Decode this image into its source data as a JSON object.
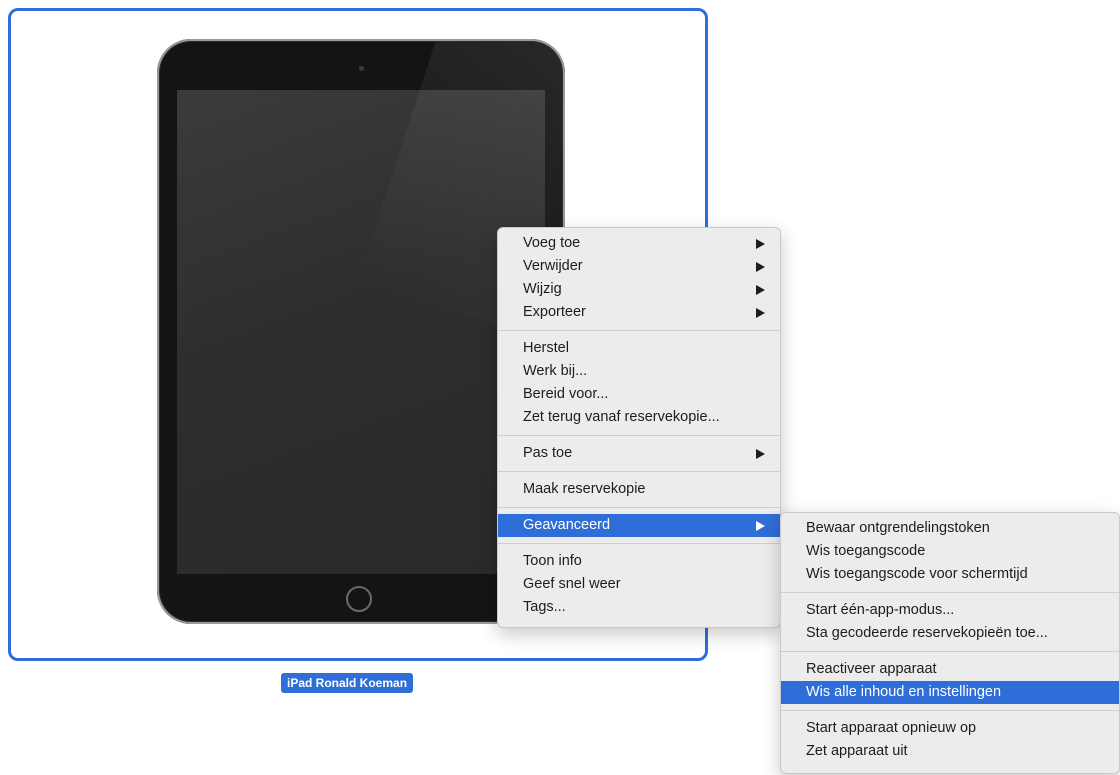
{
  "device": {
    "name": "iPad Ronald Koeman",
    "selected": true
  },
  "context_menu": {
    "groups": [
      [
        {
          "label": "Voeg toe",
          "submenu": true
        },
        {
          "label": "Verwijder",
          "submenu": true
        },
        {
          "label": "Wijzig",
          "submenu": true
        },
        {
          "label": "Exporteer",
          "submenu": true
        }
      ],
      [
        {
          "label": "Herstel"
        },
        {
          "label": "Werk bij..."
        },
        {
          "label": "Bereid voor..."
        },
        {
          "label": "Zet terug vanaf reservekopie..."
        }
      ],
      [
        {
          "label": "Pas toe",
          "submenu": true
        }
      ],
      [
        {
          "label": "Maak reservekopie"
        }
      ],
      [
        {
          "label": "Geavanceerd",
          "submenu": true,
          "highlighted": true
        }
      ],
      [
        {
          "label": "Toon info"
        },
        {
          "label": "Geef snel weer"
        },
        {
          "label": "Tags..."
        }
      ]
    ]
  },
  "advanced_submenu": {
    "groups": [
      [
        {
          "label": "Bewaar ontgrendelingstoken"
        },
        {
          "label": "Wis toegangscode"
        },
        {
          "label": "Wis toegangscode voor schermtijd"
        }
      ],
      [
        {
          "label": "Start één-app-modus..."
        },
        {
          "label": "Sta gecodeerde reservekopieën toe..."
        }
      ],
      [
        {
          "label": "Reactiveer apparaat"
        },
        {
          "label": "Wis alle inhoud en instellingen",
          "highlighted": true
        }
      ],
      [
        {
          "label": "Start apparaat opnieuw op"
        },
        {
          "label": "Zet apparaat uit"
        }
      ]
    ]
  },
  "colors": {
    "selection": "#2f6ed8",
    "menu_background": "#ececec"
  }
}
